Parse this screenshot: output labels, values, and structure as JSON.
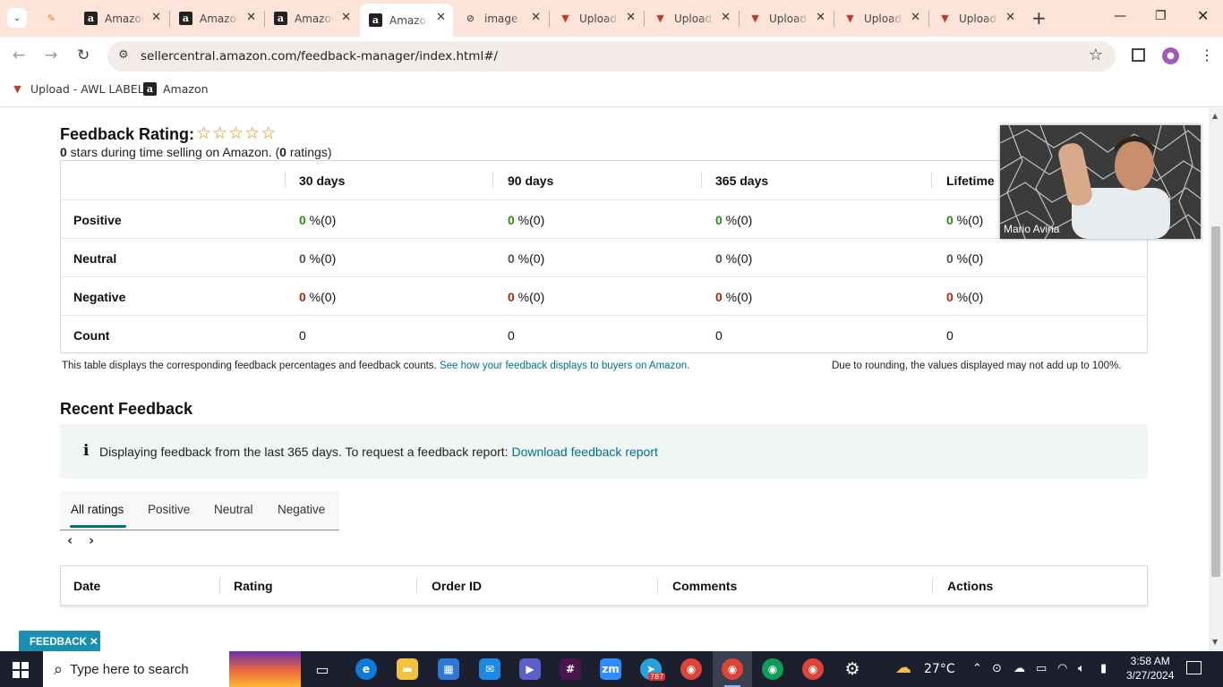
{
  "browser": {
    "tabs": [
      {
        "title": "Amazon",
        "favicon": "amazon-icon",
        "active": false
      },
      {
        "title": "Amazon",
        "favicon": "amazon-icon",
        "active": false
      },
      {
        "title": "Amazon",
        "favicon": "amazon-icon",
        "active": false
      },
      {
        "title": "Amazon",
        "favicon": "amazon-icon",
        "active": true
      },
      {
        "title": "image",
        "favicon": "image-icon",
        "active": false
      },
      {
        "title": "Upload",
        "favicon": "upload-icon",
        "active": false
      },
      {
        "title": "Upload",
        "favicon": "upload-icon",
        "active": false
      },
      {
        "title": "Upload",
        "favicon": "upload-icon",
        "active": false
      },
      {
        "title": "Upload",
        "favicon": "upload-icon",
        "active": false
      },
      {
        "title": "Upload",
        "favicon": "upload-icon",
        "active": false
      }
    ],
    "url": "sellercentral.amazon.com/feedback-manager/index.html#/",
    "bookmarks": [
      {
        "label": "Upload - AWL LABEL",
        "icon": "upload-icon"
      },
      {
        "label": "Amazon",
        "icon": "amazon-icon"
      }
    ]
  },
  "page": {
    "rating_title": "Feedback Rating:",
    "stars_outline": "☆☆☆☆☆",
    "sub_stars": "0",
    "sub_text1": " stars during time selling on Amazon. (",
    "sub_ratings": "0",
    "sub_text2": " ratings)",
    "table": {
      "headers": [
        "30 days",
        "90 days",
        "365 days",
        "Lifetime"
      ],
      "rows": [
        {
          "label": "Positive",
          "kind": "pos",
          "cells": [
            [
              "0",
              " %(0)"
            ],
            [
              "0",
              " %(0)"
            ],
            [
              "0",
              " %(0)"
            ],
            [
              "0",
              " %(0)"
            ]
          ]
        },
        {
          "label": "Neutral",
          "kind": "neu",
          "cells": [
            [
              "0",
              " %(0)"
            ],
            [
              "0",
              " %(0)"
            ],
            [
              "0",
              " %(0)"
            ],
            [
              "0",
              " %(0)"
            ]
          ]
        },
        {
          "label": "Negative",
          "kind": "neg",
          "cells": [
            [
              "0",
              " %(0)"
            ],
            [
              "0",
              " %(0)"
            ],
            [
              "0",
              " %(0)"
            ],
            [
              "0",
              " %(0)"
            ]
          ]
        },
        {
          "label": "Count",
          "kind": "count",
          "cells": [
            [
              "",
              "0"
            ],
            [
              "",
              "0"
            ],
            [
              "",
              "0"
            ],
            [
              "",
              "0"
            ]
          ]
        }
      ]
    },
    "note_left": "This table displays the corresponding feedback percentages and feedback counts.",
    "note_link": "See how your feedback displays to buyers on Amazon.",
    "note_right": "Due to rounding, the values displayed may not add up to 100%.",
    "recent_title": "Recent Feedback",
    "info_text": "Displaying feedback from the last 365 days. To request a feedback report:",
    "info_link": "Download feedback report",
    "filter_tabs": [
      "All ratings",
      "Positive",
      "Neutral",
      "Negative"
    ],
    "feedback_columns": [
      "Date",
      "Rating",
      "Order ID",
      "Comments",
      "Actions"
    ],
    "feedback_button": "FEEDBACK ✕"
  },
  "video": {
    "name": "Mario Avina"
  },
  "taskbar": {
    "search_placeholder": "Type here to search",
    "weather": "27°C",
    "time": "3:58 AM",
    "date": "3/27/2024",
    "telegram_badge": "787"
  },
  "colors": {
    "positive": "#2e8b18",
    "negative": "#b12704",
    "link": "#007185"
  }
}
